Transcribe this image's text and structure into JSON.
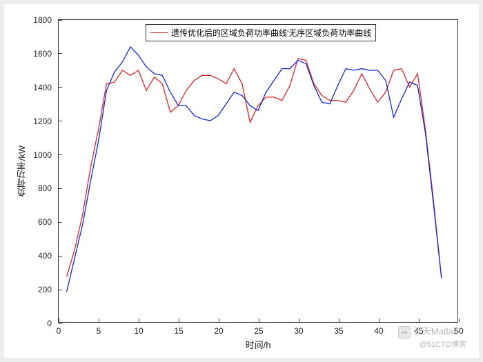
{
  "chart_data": {
    "type": "line",
    "xlabel": "时间/h",
    "ylabel": "负荷功率/kW",
    "xlim": [
      0,
      50
    ],
    "ylim": [
      0,
      1800
    ],
    "xticks": [
      0,
      5,
      10,
      15,
      20,
      25,
      30,
      35,
      40,
      45,
      50
    ],
    "yticks": [
      0,
      200,
      400,
      600,
      800,
      1000,
      1200,
      1400,
      1600,
      1800
    ],
    "series": [
      {
        "name": "遗传优化后的区域负荷功率曲线",
        "color": "#d7262b",
        "x": [
          1,
          2,
          3,
          4,
          5,
          6,
          7,
          8,
          9,
          10,
          11,
          12,
          13,
          14,
          15,
          16,
          17,
          18,
          19,
          20,
          21,
          22,
          23,
          24,
          25,
          26,
          27,
          28,
          29,
          30,
          31,
          32,
          33,
          34,
          35,
          36,
          37,
          38,
          39,
          40,
          41,
          42,
          43,
          44,
          45,
          46,
          47,
          48
        ],
        "y": [
          270,
          430,
          640,
          920,
          1150,
          1420,
          1430,
          1500,
          1470,
          1500,
          1380,
          1460,
          1420,
          1250,
          1290,
          1380,
          1440,
          1470,
          1470,
          1450,
          1420,
          1510,
          1420,
          1190,
          1290,
          1340,
          1340,
          1320,
          1410,
          1570,
          1560,
          1420,
          1350,
          1320,
          1320,
          1310,
          1380,
          1480,
          1390,
          1310,
          1370,
          1500,
          1510,
          1400,
          1480,
          1140,
          720,
          260
        ]
      },
      {
        "name": "无序区域负荷功率曲线",
        "color": "#1227d0",
        "x": [
          1,
          2,
          3,
          4,
          5,
          6,
          7,
          8,
          9,
          10,
          11,
          12,
          13,
          14,
          15,
          16,
          17,
          18,
          19,
          20,
          21,
          22,
          23,
          24,
          25,
          26,
          27,
          28,
          29,
          30,
          31,
          32,
          33,
          34,
          35,
          36,
          37,
          38,
          39,
          40,
          41,
          42,
          43,
          44,
          45,
          46,
          47,
          48
        ],
        "y": [
          180,
          380,
          580,
          840,
          1080,
          1380,
          1490,
          1550,
          1640,
          1590,
          1520,
          1480,
          1470,
          1370,
          1290,
          1290,
          1230,
          1210,
          1200,
          1230,
          1300,
          1370,
          1350,
          1290,
          1260,
          1370,
          1440,
          1510,
          1510,
          1560,
          1540,
          1410,
          1310,
          1300,
          1410,
          1510,
          1500,
          1510,
          1500,
          1500,
          1440,
          1220,
          1330,
          1430,
          1410,
          1120,
          700,
          260
        ]
      }
    ],
    "legend_text": "遗传优化后的区域负荷功率曲线'无序区域负荷功率曲线"
  },
  "watermark": {
    "line1": "天天Matlab",
    "line2": "@51CTO博客"
  }
}
